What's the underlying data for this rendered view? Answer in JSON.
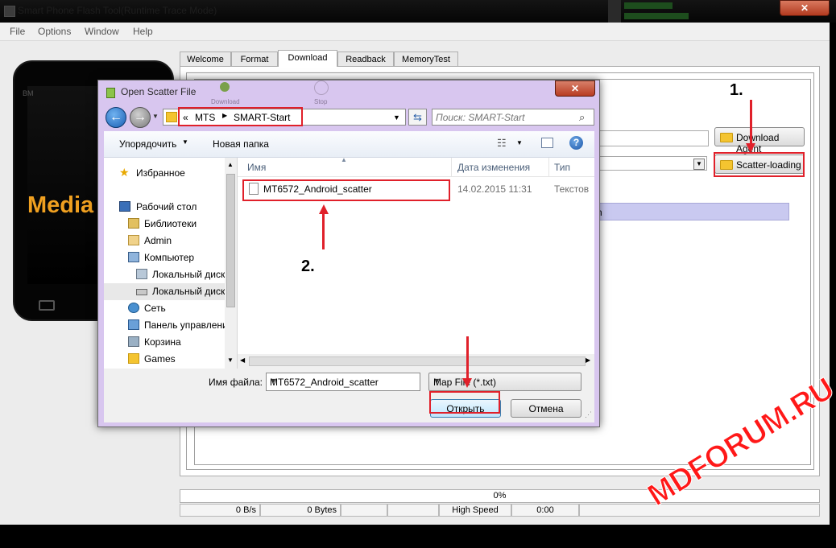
{
  "window": {
    "title": "Smart Phone Flash Tool(Runtime Trace Mode)",
    "close_glyph": "✕"
  },
  "menu": [
    "File",
    "Options",
    "Window",
    "Help"
  ],
  "tabs": [
    "Welcome",
    "Format",
    "Download",
    "Readback",
    "MemoryTest"
  ],
  "active_tab": "Download",
  "phone": {
    "label": "Media",
    "badge": "BM"
  },
  "buttons": {
    "download_agent": "Download Agent",
    "scatter_loading": "Scatter-loading"
  },
  "status": {
    "progress": "0%",
    "speed": "0 B/s",
    "bytes": "0 Bytes",
    "mode": "High Speed",
    "time": "0:00"
  },
  "dialog": {
    "title": "Open Scatter File",
    "close_glyph": "✕",
    "ghost_toolbar": {
      "left": "Download",
      "right": "Stop"
    },
    "breadcrumb": {
      "prefix": "«",
      "parts": [
        "MTS",
        "SMART-Start"
      ]
    },
    "search_placeholder": "Поиск: SMART-Start",
    "toolbar": {
      "organize": "Упорядочить",
      "new_folder": "Новая папка"
    },
    "nav_items": [
      {
        "label": "Избранное",
        "icon": "star-icon",
        "level": 0
      },
      {
        "label": "Рабочий стол",
        "icon": "desktop-icon",
        "level": 0
      },
      {
        "label": "Библиотеки",
        "icon": "library-icon",
        "level": 1
      },
      {
        "label": "Admin",
        "icon": "user-folder-icon",
        "level": 1
      },
      {
        "label": "Компьютер",
        "icon": "computer-icon",
        "level": 1
      },
      {
        "label": "Локальный диск",
        "icon": "drive-icon",
        "level": 2
      },
      {
        "label": "Локальный диск",
        "icon": "drive-icon",
        "level": 2
      },
      {
        "label": "Сеть",
        "icon": "network-icon",
        "level": 1
      },
      {
        "label": "Панель управления",
        "icon": "control-panel-icon",
        "level": 1
      },
      {
        "label": "Корзина",
        "icon": "recycle-bin-icon",
        "level": 1
      },
      {
        "label": "Games",
        "icon": "folder-icon",
        "level": 1
      }
    ],
    "columns": {
      "name": "Имя",
      "date": "Дата изменения",
      "type": "Тип"
    },
    "files": [
      {
        "name": "MT6572_Android_scatter",
        "date": "14.02.2015 11:31",
        "type": "Текстовы"
      }
    ],
    "filename_label": "Имя файла:",
    "filename_value": "MT6572_Android_scatter",
    "filetype": "Map File (*.txt)",
    "open": "Открыть",
    "cancel": "Отмена"
  },
  "annotations": {
    "step1": "1.",
    "step2": "2."
  },
  "watermark": "MDFORUM.RU",
  "colors": {
    "annotation_red": "#e0202a",
    "dialog_frame": "#d8c6ef",
    "selection": "#c9c9f0"
  }
}
